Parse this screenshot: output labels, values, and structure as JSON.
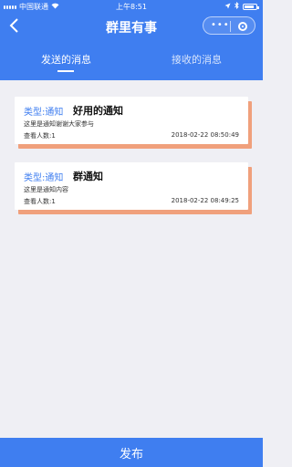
{
  "status_bar": {
    "carrier": "中国联通",
    "time": "上午8:51"
  },
  "nav": {
    "title": "群里有事"
  },
  "tabs": [
    {
      "label": "发送的消息",
      "active": true
    },
    {
      "label": "接收的消息",
      "active": false
    }
  ],
  "messages": [
    {
      "type": "类型:通知",
      "title": "好用的通知",
      "content": "这里是通知谢谢大家参与",
      "viewers": "查看人数:1",
      "time": "2018-02-22 08:50:49"
    },
    {
      "type": "类型:通知",
      "title": "群通知",
      "content": "这里是通知内容",
      "viewers": "查看人数:1",
      "time": "2018-02-22 08:49:25"
    }
  ],
  "footer": {
    "publish_label": "发布"
  },
  "colors": {
    "brand": "#3f7ef0",
    "card_shadow": "#f0a07c"
  }
}
